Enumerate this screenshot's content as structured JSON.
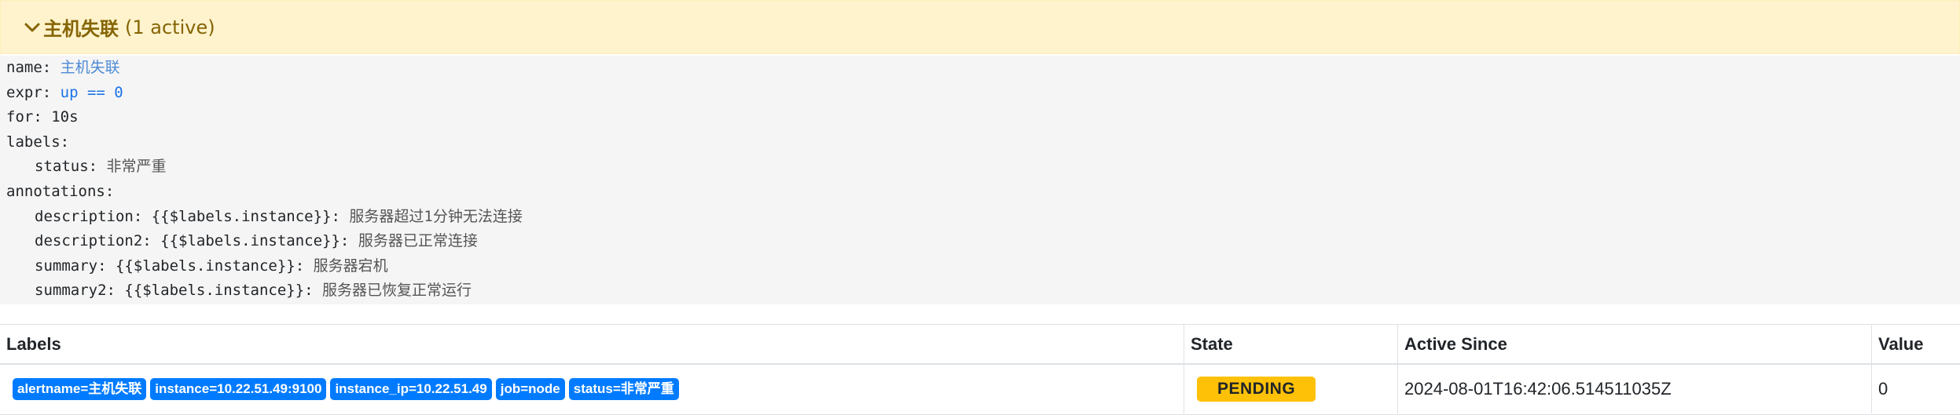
{
  "alert_group": {
    "title": "主机失联",
    "active_count": "(1 active)"
  },
  "rule": {
    "name_key": "name: ",
    "name_value": "主机失联",
    "expr_key": "expr: ",
    "expr_value": "up == 0",
    "for_line": "for: 10s",
    "labels_key": "labels:",
    "status_key": "status: ",
    "status_value": "非常严重",
    "annotations_key": "annotations:",
    "desc_key": "description: {{$labels.instance}}: ",
    "desc_value": "服务器超过1分钟无法连接",
    "desc2_key": "description2: {{$labels.instance}}: ",
    "desc2_value": "服务器已正常连接",
    "summary_key": "summary: {{$labels.instance}}: ",
    "summary_value": "服务器宕机",
    "summary2_key": "summary2: {{$labels.instance}}: ",
    "summary2_value": "服务器已恢复正常运行"
  },
  "table": {
    "headers": {
      "labels": "Labels",
      "state": "State",
      "active_since": "Active Since",
      "value": "Value"
    },
    "rows": [
      {
        "labels": [
          "alertname=主机失联",
          "instance=10.22.51.49:9100",
          "instance_ip=10.22.51.49",
          "job=node",
          "status=非常严重"
        ],
        "state": "PENDING",
        "active_since": "2024-08-01T16:42:06.514511035Z",
        "value": "0"
      }
    ]
  },
  "colors": {
    "header_bg": "#fff3cd",
    "header_text": "#856404",
    "badge_bg": "#007bff",
    "pending_bg": "#ffc107"
  },
  "icons": {
    "collapse": "chevron-down-icon"
  }
}
